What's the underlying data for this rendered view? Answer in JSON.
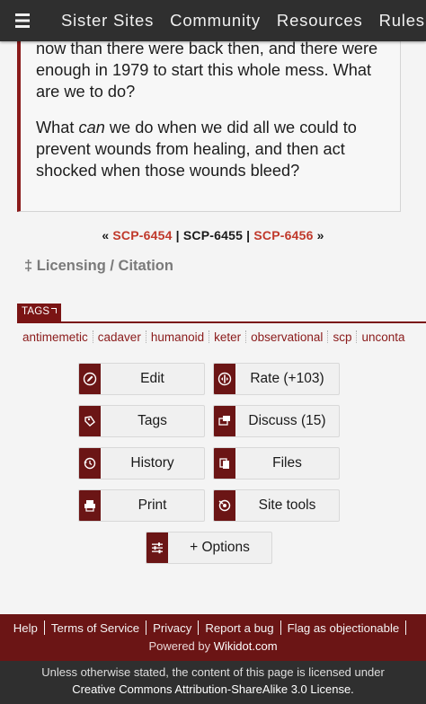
{
  "nav": {
    "items": [
      "Sister Sites",
      "Community",
      "Resources",
      "Rules"
    ]
  },
  "article": {
    "p1": "now than there were back then, and there were enough in 1979 to start this whole mess. What are we to do?",
    "p2_before": "What ",
    "p2_em": "can",
    "p2_after": " we do when we did all we could to prevent wounds from healing, and then act shocked when those wounds bleed?"
  },
  "scp_nav": {
    "open": "« ",
    "prev": "SCP-6454",
    "sep": " | ",
    "current": "SCP-6455",
    "next": "SCP-6456",
    "close": " »"
  },
  "licensing": "‡ Licensing / Citation",
  "tags": {
    "heading": "TAGS",
    "items": [
      "antimemetic",
      "cadaver",
      "humanoid",
      "keter",
      "observational",
      "scp",
      "unconta"
    ]
  },
  "buttons": {
    "edit": "Edit",
    "rate": "Rate (+103)",
    "tags": "Tags",
    "discuss": "Discuss (15)",
    "history": "History",
    "files": "Files",
    "print": "Print",
    "site_tools": "Site tools",
    "options": "+ Options"
  },
  "footer": {
    "links": [
      "Help",
      "Terms of Service",
      "Privacy",
      "Report a bug",
      "Flag as objectionable"
    ],
    "powered_prefix": "Powered by ",
    "powered_link": "Wikidot.com"
  },
  "license": {
    "line1": "Unless otherwise stated, the content of this page is licensed under",
    "line2": "Creative Commons Attribution-ShareAlike 3.0 License."
  },
  "colors": {
    "accent": "#6b1515",
    "link": "#c0392b",
    "nav_bg": "#2f2f2f"
  }
}
